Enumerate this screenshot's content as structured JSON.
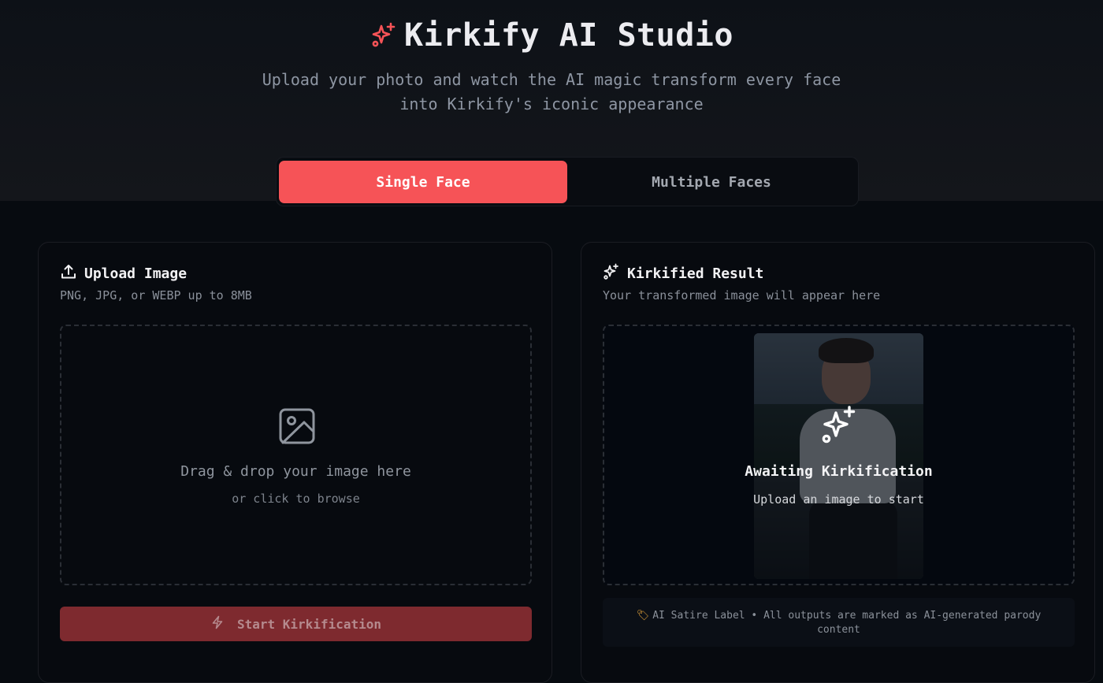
{
  "header": {
    "logo_icon": "sparkles-icon",
    "title": "Kirkify AI Studio",
    "subtitle_line1": "Upload your photo and watch the AI magic transform every face",
    "subtitle_line2": "into Kirkify's iconic appearance",
    "accent_color": "#f65357"
  },
  "mode_toggle": {
    "options": [
      {
        "label": "Single Face",
        "active": true
      },
      {
        "label": "Multiple Faces",
        "active": false
      }
    ]
  },
  "upload_card": {
    "icon": "upload-icon",
    "title": "Upload Image",
    "subtitle": "PNG, JPG, or WEBP up to 8MB",
    "dropzone": {
      "icon": "image-icon",
      "main_text": "Drag & drop your image here",
      "sub_text": "or click to browse"
    },
    "start_button": {
      "icon": "lightning-icon",
      "label": "Start Kirkification",
      "disabled": true
    }
  },
  "result_card": {
    "icon": "sparkles-icon",
    "title": "Kirkified Result",
    "subtitle": "Your transformed image will appear here",
    "placeholder": {
      "icon": "sparkles-icon",
      "title": "Awaiting Kirkification",
      "sub_text": "Upload an image to start"
    },
    "satire_label": {
      "icon": "tag-icon",
      "text": "AI Satire Label • All outputs are marked as AI-generated parody content"
    }
  }
}
